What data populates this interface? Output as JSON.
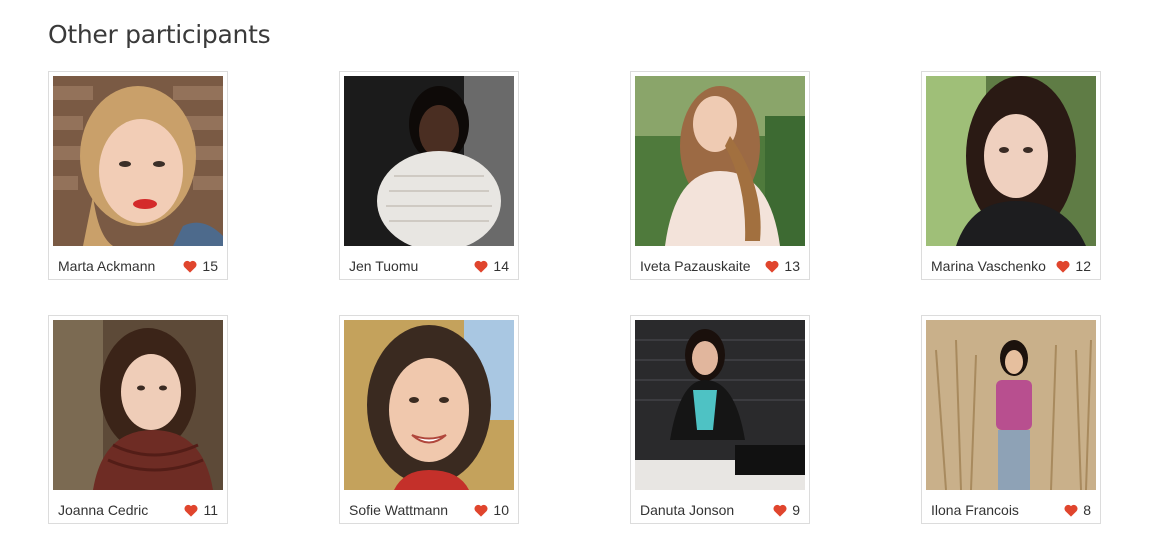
{
  "section": {
    "title": "Other participants"
  },
  "colors": {
    "heart": "#e0452d",
    "border": "#dcdcdc",
    "text": "#333333"
  },
  "participants": [
    {
      "name": "Marta Ackmann",
      "likes": "15"
    },
    {
      "name": "Jen Tuomu",
      "likes": "14"
    },
    {
      "name": "Iveta Pazauskaite",
      "likes": "13"
    },
    {
      "name": "Marina Vaschenko",
      "likes": "12"
    },
    {
      "name": "Joanna Cedric",
      "likes": "11"
    },
    {
      "name": "Sofie Wattmann",
      "likes": "10"
    },
    {
      "name": "Danuta Jonson",
      "likes": "9"
    },
    {
      "name": "Ilona Francois",
      "likes": "8"
    }
  ]
}
